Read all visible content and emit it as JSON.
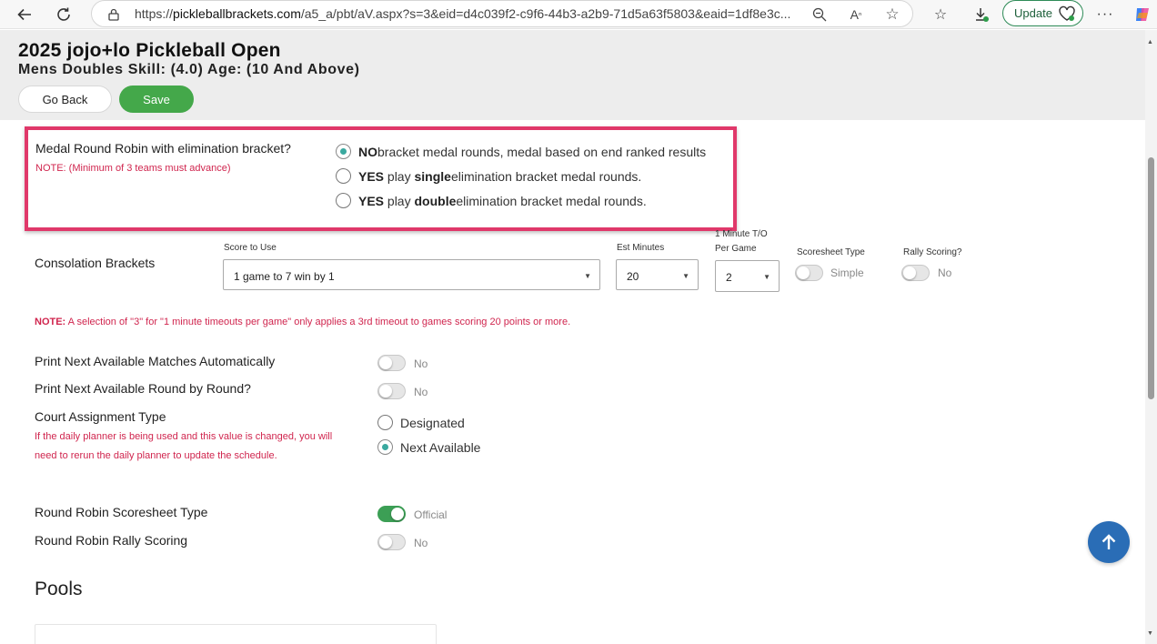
{
  "browser": {
    "url_prefix": "https://",
    "url_host": "pickleballbrackets.com",
    "url_path": "/a5_a/pbt/aV.aspx?s=3&eid=d4c039f2-c9f6-44b3-a2b9-71d5a63f5803&eaid=1df8e3c...",
    "update_label": "Update"
  },
  "header": {
    "title": "2025 jojo+lo Pickleball Open",
    "subtitle": "Mens Doubles Skill: (4.0) Age: (10 And Above)",
    "back_label": "Go Back",
    "save_label": "Save"
  },
  "medal": {
    "label": "Medal Round Robin with elimination bracket?",
    "note": "NOTE: (Minimum of 3 teams must advance)",
    "options": [
      {
        "bold": "NO",
        "pre": "",
        "mid": " bracket medal rounds, medal based on end ranked results",
        "strong": "",
        "post": "",
        "checked": true
      },
      {
        "bold": "YES",
        "pre": " play ",
        "strong": "single",
        "post": " elimination bracket medal rounds.",
        "checked": false
      },
      {
        "bold": "YES",
        "pre": " play ",
        "strong": "double",
        "post": " elimination bracket medal rounds.",
        "checked": false
      }
    ]
  },
  "consolation": {
    "label": "Consolation Brackets",
    "score_label": "Score to Use",
    "score_value": "1 game to 7 win by 1",
    "est_label": "Est Minutes",
    "est_value": "20",
    "to_label_1": "1 Minute T/O",
    "to_label_2": "Per Game",
    "to_value": "2",
    "scoresheet_label": "Scoresheet Type",
    "scoresheet_value": "Simple",
    "rally_label": "Rally Scoring?",
    "rally_value": "No"
  },
  "timeout_note": {
    "prefix": "NOTE:",
    "text": " A selection of \"3\" for \"1 minute timeouts per game\" only applies a 3rd timeout to games scoring 20 points or more."
  },
  "settings": {
    "print_next_matches": {
      "label": "Print Next Available Matches Automatically",
      "value": "No"
    },
    "print_next_round": {
      "label": "Print Next Available Round by Round?",
      "value": "No"
    },
    "court_assignment": {
      "label": "Court Assignment Type",
      "warning_1": "If the daily planner is being used and this value is changed, you will",
      "warning_2": "need to rerun the daily planner to update the schedule.",
      "options": [
        "Designated",
        "Next Available"
      ],
      "selected": "Next Available"
    },
    "rr_scoresheet": {
      "label": "Round Robin Scoresheet Type",
      "value": "Official",
      "on": true
    },
    "rr_rally": {
      "label": "Round Robin Rally Scoring",
      "value": "No",
      "on": false
    }
  },
  "pools": {
    "title": "Pools"
  }
}
